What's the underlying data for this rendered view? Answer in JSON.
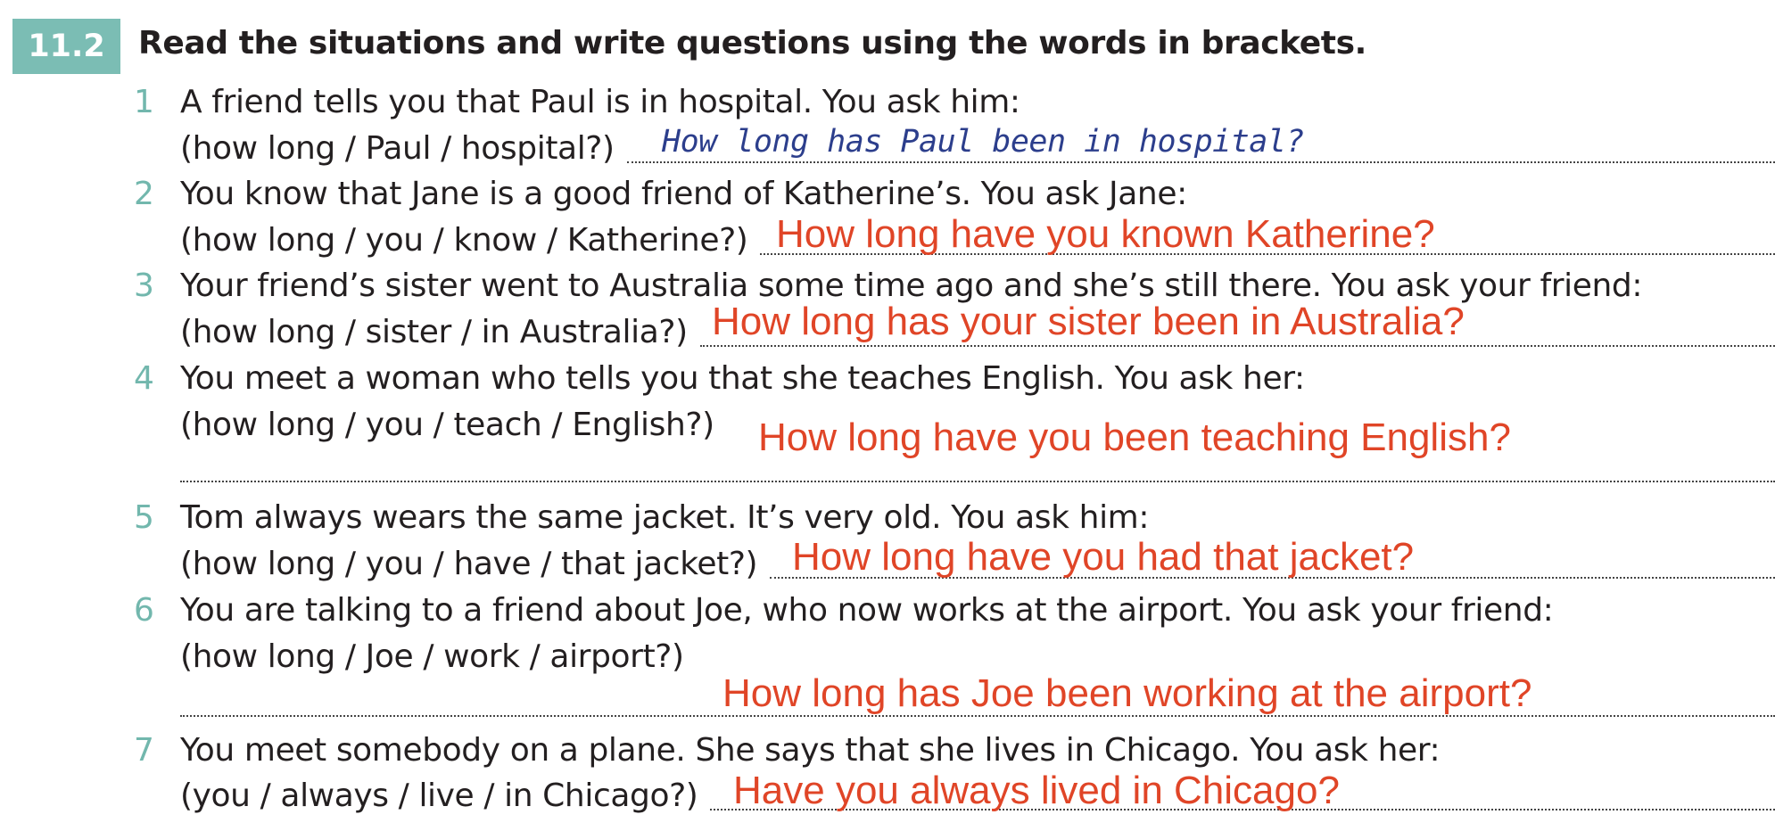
{
  "exercise": {
    "number": "11.2",
    "instruction": "Read the situations and write questions using the words in brackets."
  },
  "items": [
    {
      "num": "1",
      "situation": "A friend tells you that Paul is in hospital.  You ask him:",
      "prompt": "(how long / Paul / hospital?)",
      "answer": "How long has Paul been in hospital?"
    },
    {
      "num": "2",
      "situation": "You know that Jane is a good friend of Katherine’s.  You ask Jane:",
      "prompt": "(how long / you / know / Katherine?)",
      "answer": "How long have you known Katherine?"
    },
    {
      "num": "3",
      "situation": "Your friend’s sister went to Australia some time ago and she’s still there.  You ask your friend:",
      "prompt": "(how long / sister / in Australia?)",
      "answer": "How long has your sister been in Australia?"
    },
    {
      "num": "4",
      "situation": "You meet a woman who tells you that she teaches English.  You ask her:",
      "prompt": "(how long / you / teach / English?)",
      "answer": "How long have you been teaching English?"
    },
    {
      "num": "5",
      "situation": "Tom always wears the same jacket.  It’s very old.  You ask him:",
      "prompt": "(how long / you / have / that jacket?)",
      "answer": "How long have you had that jacket?"
    },
    {
      "num": "6",
      "situation": "You are talking to a friend about Joe, who now works at the airport.  You ask your friend:",
      "prompt": "(how long / Joe / work / airport?)",
      "answer": "How long has Joe been working at the airport?"
    },
    {
      "num": "7",
      "situation": "You meet somebody on a plane.  She says that she lives in Chicago.  You ask her:",
      "prompt": "(you / always / live / in Chicago?)",
      "answer": "Have you always lived in Chicago?"
    }
  ]
}
